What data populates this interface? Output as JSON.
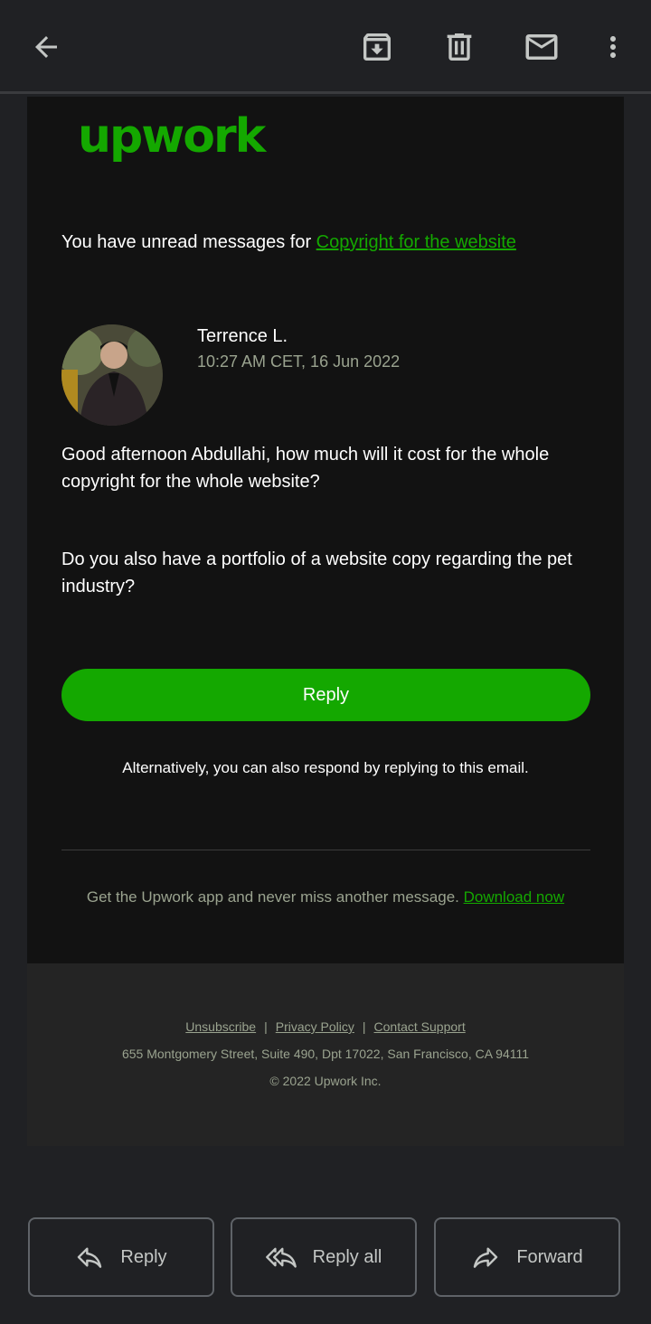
{
  "toolbar": {
    "back_icon": "arrow-back-icon",
    "archive_icon": "archive-icon",
    "delete_icon": "trash-icon",
    "mark_unread_icon": "mail-icon",
    "more_icon": "more-vert-icon"
  },
  "email": {
    "logo_text": "upwork",
    "unread_prefix": "You have unread messages for ",
    "unread_link": "Copyright for the website",
    "sender_name": "Terrence L.",
    "sender_time": "10:27 AM CET, 16 Jun 2022",
    "message_paragraph_1": "Good afternoon Abdullahi, how much will it cost for the whole copyright for the whole website?",
    "message_paragraph_2": "Do you also have a portfolio of a website copy regarding the pet industry?",
    "reply_button": "Reply",
    "alternative_text": "Alternatively, you can also respond by replying to this email.",
    "app_promo_text": "Get the Upwork app and never miss another message. ",
    "app_promo_link": "Download now"
  },
  "footer": {
    "unsubscribe": "Unsubscribe",
    "separator": "|",
    "privacy_policy": "Privacy Policy",
    "contact_support": "Contact Support",
    "address": "655 Montgomery Street, Suite 490, Dpt 17022, San Francisco, CA 94111",
    "copyright": "© 2022 Upwork Inc."
  },
  "actions": {
    "reply": "Reply",
    "reply_all": "Reply all",
    "forward": "Forward"
  },
  "colors": {
    "brand_green": "#14a800",
    "background": "#202124",
    "email_background": "#121212"
  }
}
